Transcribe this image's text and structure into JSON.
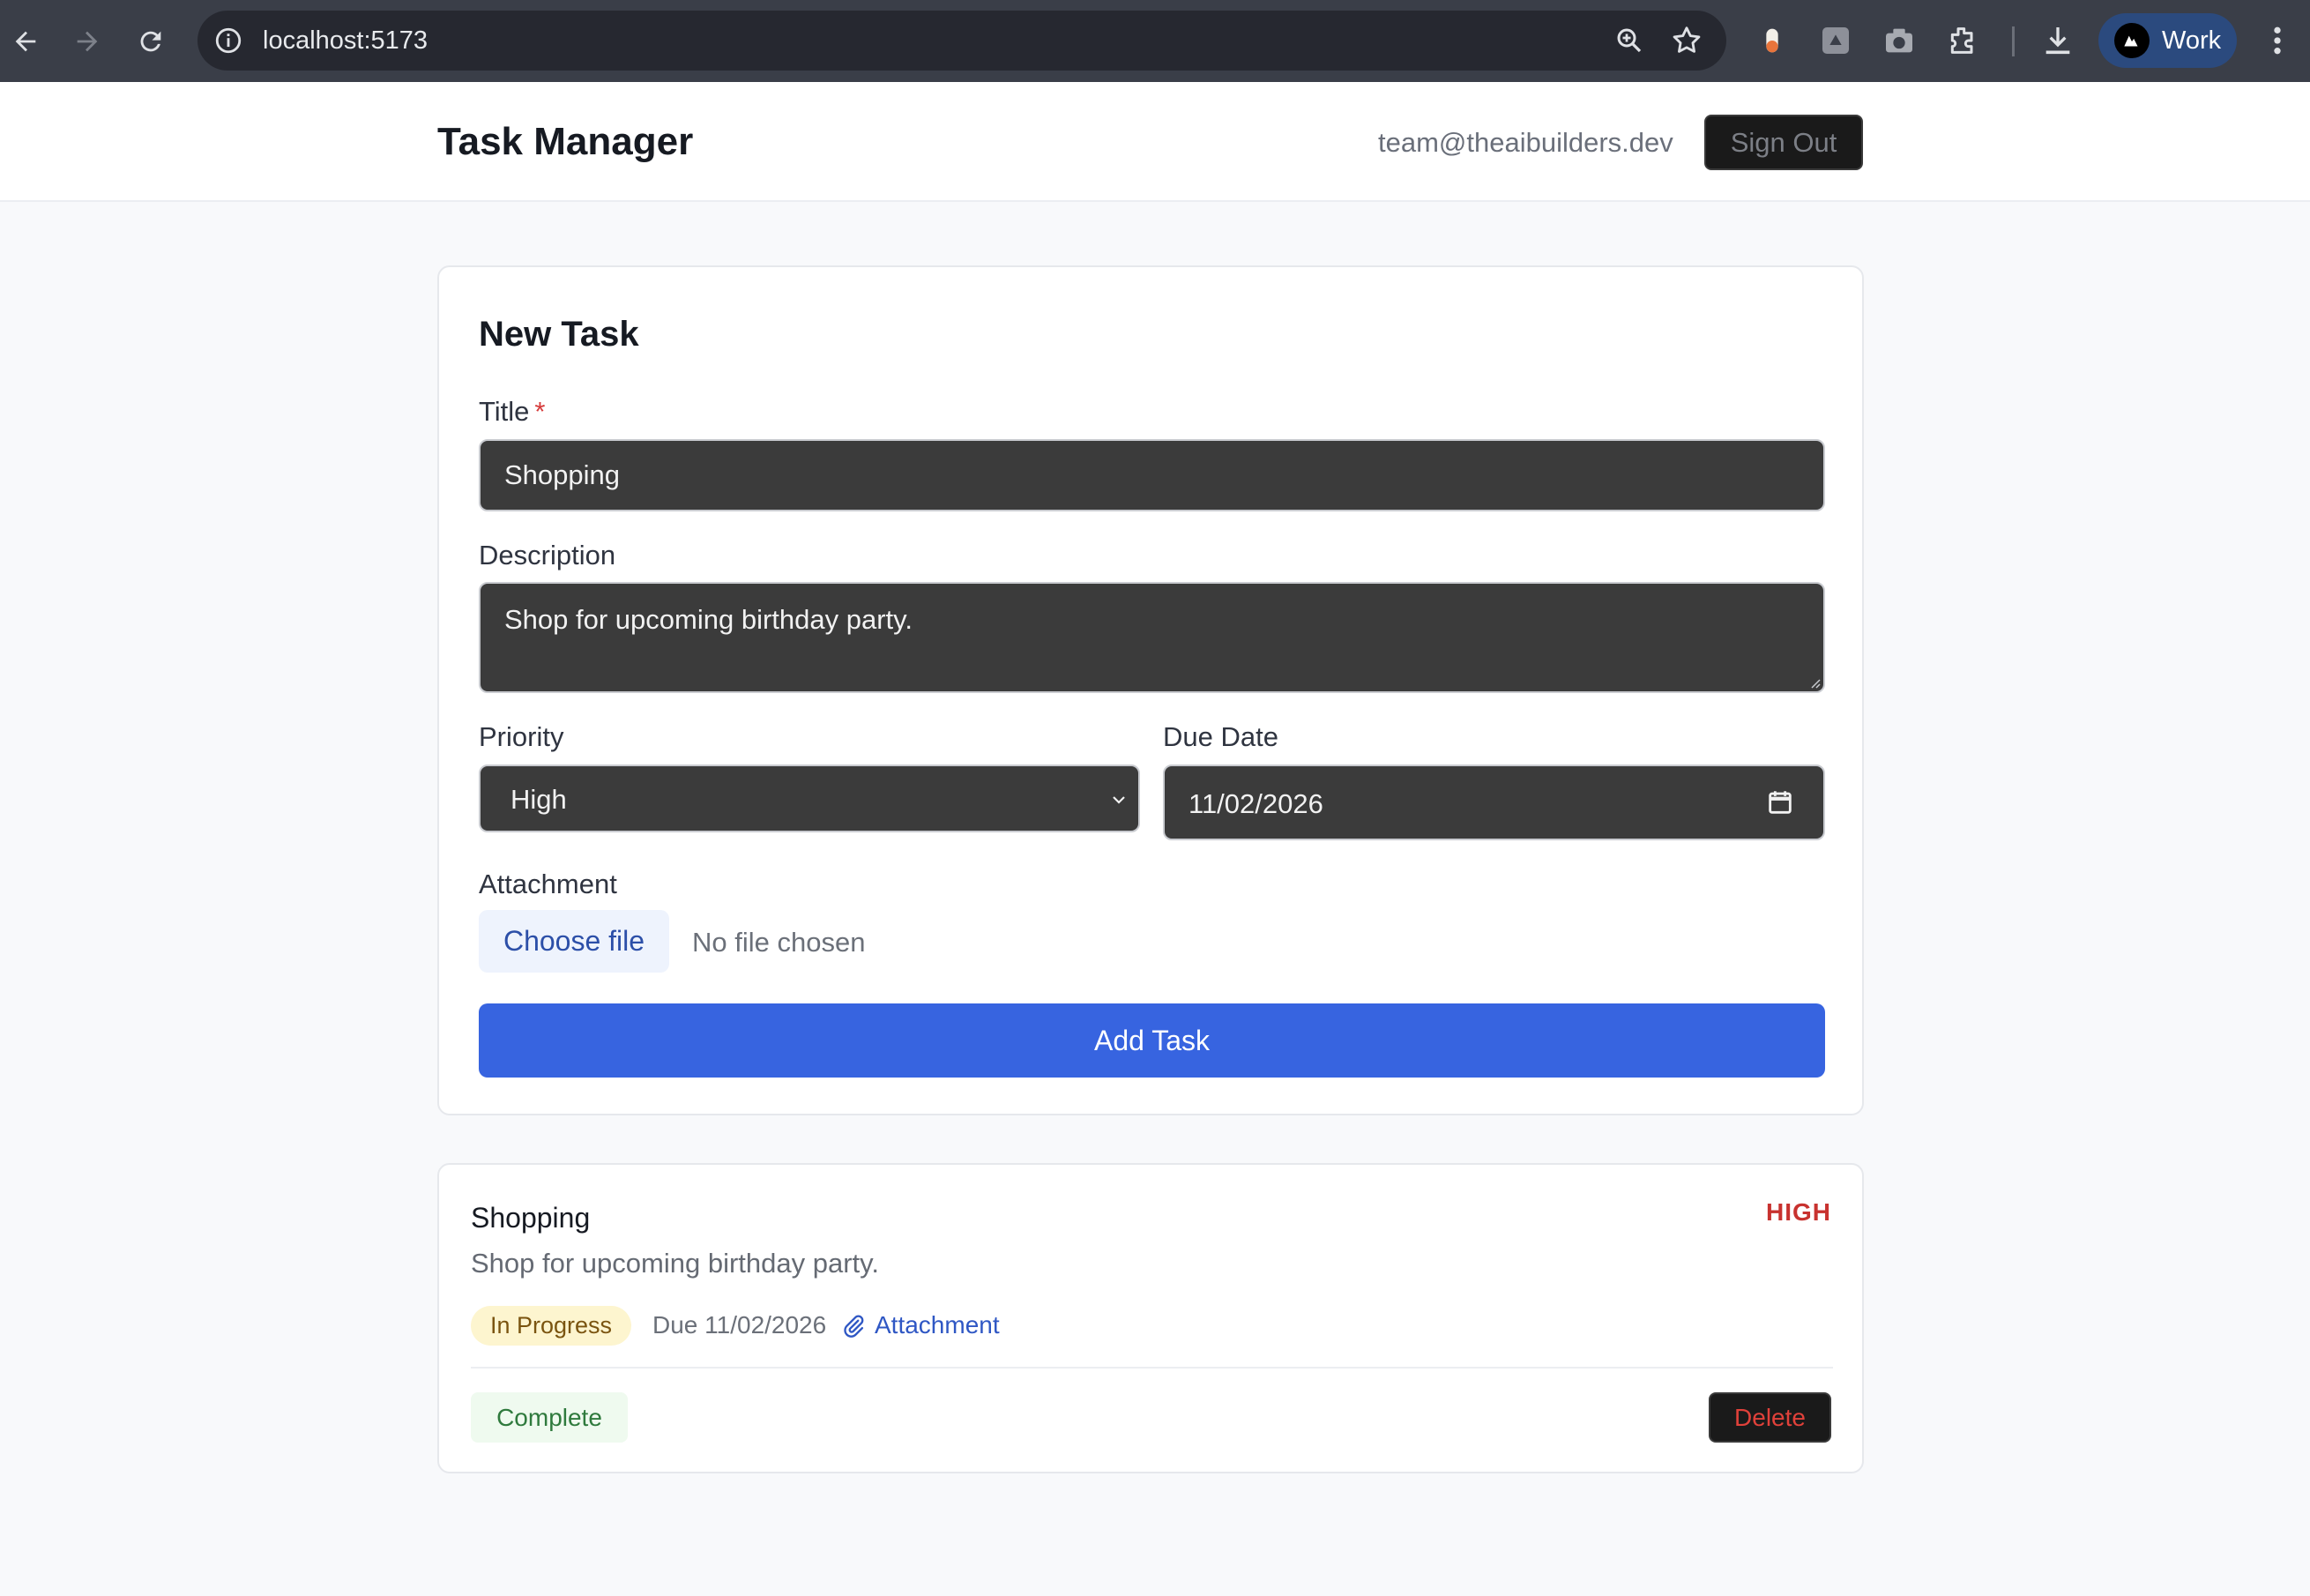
{
  "browser": {
    "url": "localhost:5173",
    "profile_label": "Work",
    "icons": [
      "back-arrow-icon",
      "forward-arrow-icon",
      "reload-icon",
      "site-info-icon",
      "zoom-icon",
      "bookmark-star-icon",
      "extension-icon",
      "downloads-icon",
      "menu-dots-icon"
    ]
  },
  "header": {
    "title": "Task Manager",
    "user_email": "team@theaibuilders.dev",
    "sign_out_label": "Sign Out"
  },
  "form": {
    "heading": "New Task",
    "title_label": "Title",
    "title_required_mark": "*",
    "title_value": "Shopping",
    "description_label": "Description",
    "description_value": "Shop for upcoming birthday party.",
    "priority_label": "Priority",
    "priority_value": "High",
    "due_date_label": "Due Date",
    "due_date_value": "11/02/2026",
    "attachment_label": "Attachment",
    "choose_file_label": "Choose file",
    "no_file_text": "No file chosen",
    "submit_label": "Add Task",
    "accent_color": "#3764e0"
  },
  "tasks": [
    {
      "title": "Shopping",
      "priority": "HIGH",
      "priority_color": "#c8322f",
      "description": "Shop for upcoming birthday party.",
      "status": "In Progress",
      "due": "Due 11/02/2026",
      "attachment_label": "Attachment",
      "complete_label": "Complete",
      "delete_label": "Delete"
    }
  ]
}
